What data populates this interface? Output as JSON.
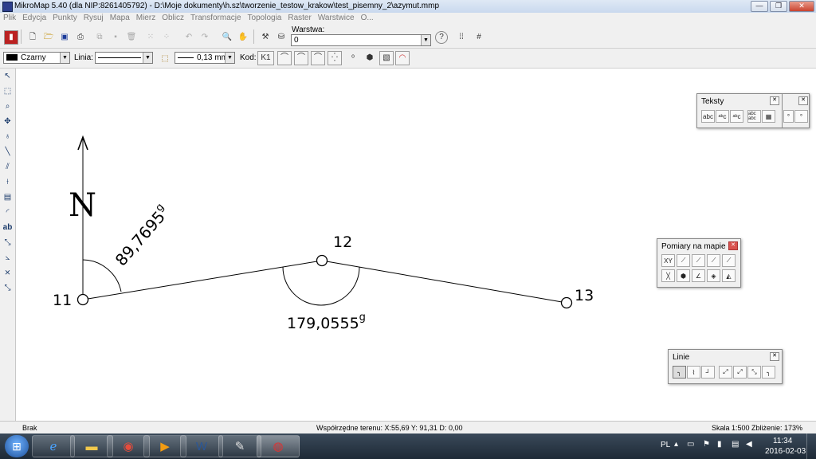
{
  "window": {
    "title": "MikroMap 5.40 (dla NIP:8261405792)  - D:\\Moje dokumenty\\h.sz\\tworzenie_testow_krakow\\test_pisemny_2\\azymut.mmp",
    "minimize": "—",
    "restore": "❐",
    "close": "✕"
  },
  "menu": [
    "Plik",
    "Edycja",
    "Punkty",
    "Rysuj",
    "Mapa",
    "Mierz",
    "Oblicz",
    "Transformacje",
    "Topologia",
    "Raster",
    "Warstwice",
    "O..."
  ],
  "toolbar1": {
    "layer_label": "Warstwa:",
    "layer_value": "0",
    "help": "?"
  },
  "toolbar2": {
    "color_value": "Czarny",
    "line_label": "Linia:",
    "width_value": "0,13 mm",
    "code_label": "Kod:",
    "code_button": "K1"
  },
  "map": {
    "north": "N",
    "angle1": "89,7695",
    "angle1_unit": "g",
    "angle2": "179,0555",
    "angle2_unit": "g",
    "points": [
      {
        "label": "11"
      },
      {
        "label": "12"
      },
      {
        "label": "13"
      }
    ]
  },
  "palettes": {
    "teksty": {
      "title": "Teksty",
      "buttons": [
        "abc",
        "ᵃᵇc",
        "ᵃᵇc",
        "abc abc",
        "▦",
        "°",
        "°"
      ]
    },
    "pomiary": {
      "title": "Pomiary na mapie",
      "buttons": [
        "XY",
        "⟋",
        "⟋",
        "⟋",
        "⟋",
        "╳",
        "⬢",
        "∠",
        "◈",
        "◭"
      ]
    },
    "linie": {
      "title": "Linie",
      "buttons": [
        "╮",
        "⌇",
        "┘",
        "⤢",
        "⤢",
        "⤡",
        "╮"
      ]
    }
  },
  "status": {
    "left": "Brak",
    "coords": "Współrzędne terenu: X:55,69 Y: 91,31  D: 0,00",
    "scale": "Skala 1:500",
    "zoom": "Zbliżenie: 173%"
  },
  "taskbar": {
    "lang": "PL",
    "time": "11:34",
    "date": "2016-02-03"
  }
}
